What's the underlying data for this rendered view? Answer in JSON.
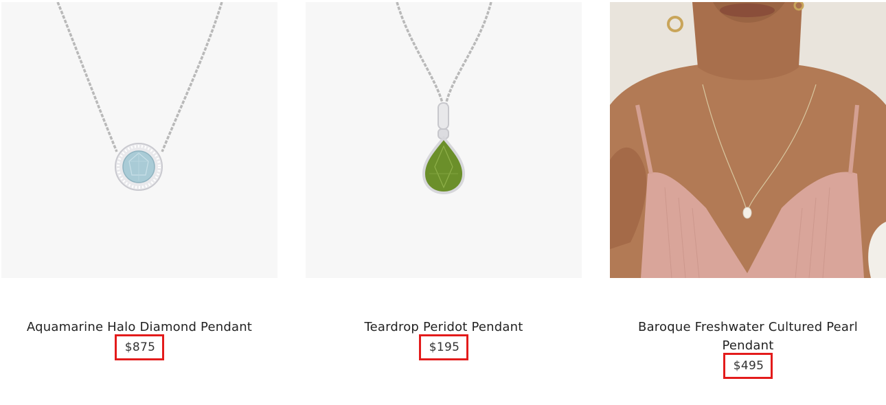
{
  "products": [
    {
      "name": "Aquamarine Halo Diamond Pendant",
      "price": "$875",
      "image_icon": "aquamarine-halo-pendant-image",
      "gem_color": "#a9cbd6"
    },
    {
      "name": "Teardrop Peridot Pendant",
      "price": "$195",
      "image_icon": "peridot-teardrop-pendant-image",
      "gem_color": "#6b8f2a"
    },
    {
      "name": "Baroque Freshwater Cultured Pearl Pendant",
      "price": "$495",
      "image_icon": "pearl-pendant-model-image",
      "gem_color": "#f4efe6"
    }
  ],
  "colors": {
    "highlight_border": "#e31b1b",
    "image_background": "#f7f7f7"
  }
}
